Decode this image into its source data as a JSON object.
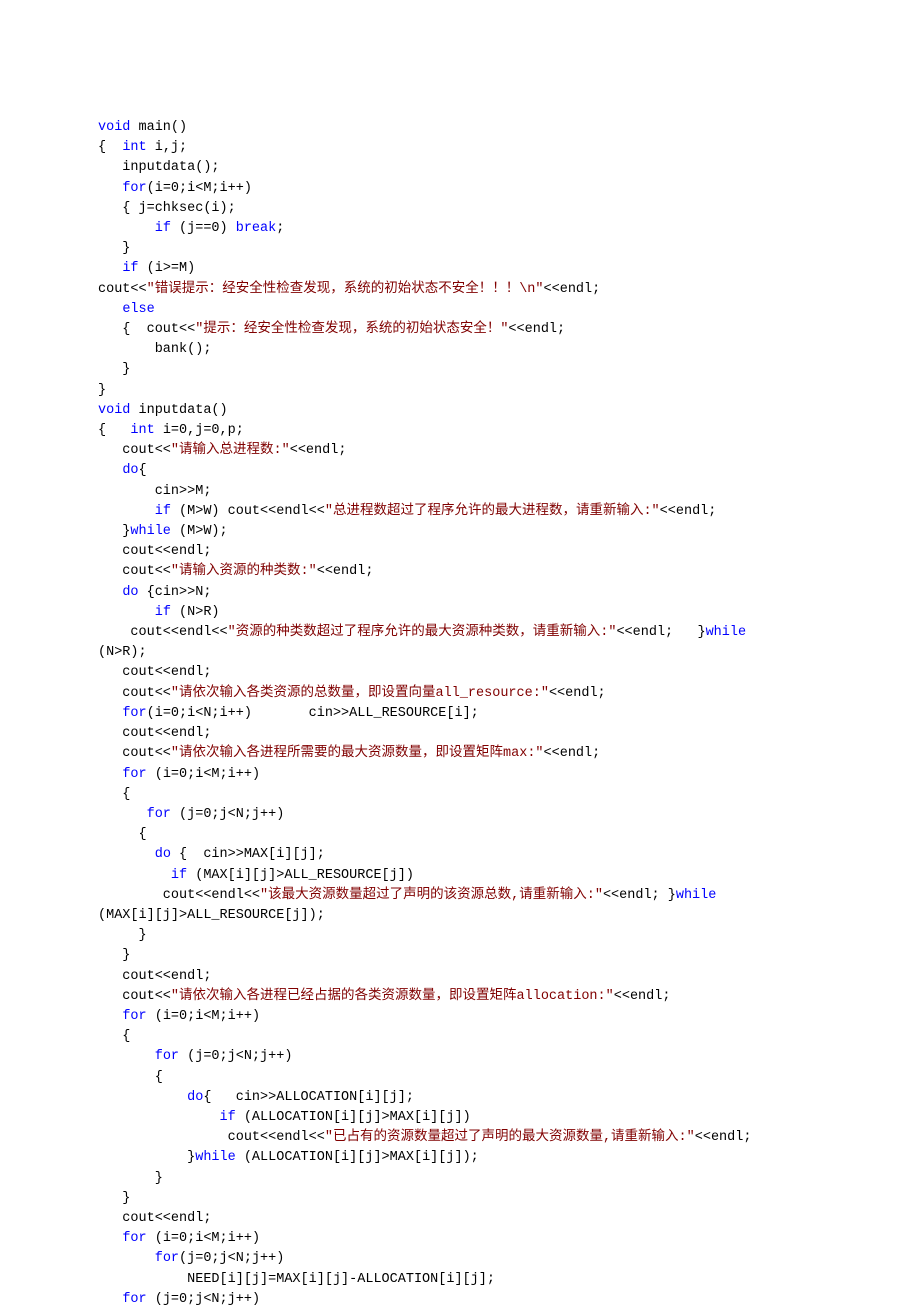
{
  "code": {
    "lines": [
      [
        {
          "c": "tp",
          "t": "void"
        },
        {
          "c": "",
          "t": " main()"
        }
      ],
      [
        {
          "c": "",
          "t": "{  "
        },
        {
          "c": "tp",
          "t": "int"
        },
        {
          "c": "",
          "t": " i,j;"
        }
      ],
      [
        {
          "c": "",
          "t": "   inputdata();"
        }
      ],
      [
        {
          "c": "",
          "t": "   "
        },
        {
          "c": "kw",
          "t": "for"
        },
        {
          "c": "",
          "t": "(i=0;i<M;i++)"
        }
      ],
      [
        {
          "c": "",
          "t": "   { j=chksec(i);"
        }
      ],
      [
        {
          "c": "",
          "t": "       "
        },
        {
          "c": "kw",
          "t": "if"
        },
        {
          "c": "",
          "t": " (j==0) "
        },
        {
          "c": "kw",
          "t": "break"
        },
        {
          "c": "",
          "t": ";"
        }
      ],
      [
        {
          "c": "",
          "t": "   }"
        }
      ],
      [
        {
          "c": "",
          "t": "   "
        },
        {
          "c": "kw",
          "t": "if"
        },
        {
          "c": "",
          "t": " (i>=M)"
        }
      ],
      [
        {
          "c": "",
          "t": "cout<<"
        },
        {
          "c": "str",
          "t": "\"错误提示：经安全性检查发现，系统的初始状态不安全！！！\\n\""
        },
        {
          "c": "",
          "t": "<<endl;"
        }
      ],
      [
        {
          "c": "",
          "t": "   "
        },
        {
          "c": "kw",
          "t": "else"
        }
      ],
      [
        {
          "c": "",
          "t": "   {  cout<<"
        },
        {
          "c": "str",
          "t": "\"提示：经安全性检查发现，系统的初始状态安全！\""
        },
        {
          "c": "",
          "t": "<<endl;"
        }
      ],
      [
        {
          "c": "",
          "t": "       bank();"
        }
      ],
      [
        {
          "c": "",
          "t": "   }"
        }
      ],
      [
        {
          "c": "",
          "t": "}"
        }
      ],
      [
        {
          "c": "tp",
          "t": "void"
        },
        {
          "c": "",
          "t": " inputdata()"
        }
      ],
      [
        {
          "c": "",
          "t": "{   "
        },
        {
          "c": "tp",
          "t": "int"
        },
        {
          "c": "",
          "t": " i=0,j=0,p;"
        }
      ],
      [
        {
          "c": "",
          "t": "   cout<<"
        },
        {
          "c": "str",
          "t": "\"请输入总进程数:\""
        },
        {
          "c": "",
          "t": "<<endl;"
        }
      ],
      [
        {
          "c": "",
          "t": "   "
        },
        {
          "c": "kw",
          "t": "do"
        },
        {
          "c": "",
          "t": "{"
        }
      ],
      [
        {
          "c": "",
          "t": "       cin>>M;"
        }
      ],
      [
        {
          "c": "",
          "t": "       "
        },
        {
          "c": "kw",
          "t": "if"
        },
        {
          "c": "",
          "t": " (M>W) cout<<endl<<"
        },
        {
          "c": "str",
          "t": "\"总进程数超过了程序允许的最大进程数，请重新输入:\""
        },
        {
          "c": "",
          "t": "<<endl;"
        }
      ],
      [
        {
          "c": "",
          "t": "   }"
        },
        {
          "c": "kw",
          "t": "while"
        },
        {
          "c": "",
          "t": " (M>W);"
        }
      ],
      [
        {
          "c": "",
          "t": "   cout<<endl;"
        }
      ],
      [
        {
          "c": "",
          "t": "   cout<<"
        },
        {
          "c": "str",
          "t": "\"请输入资源的种类数:\""
        },
        {
          "c": "",
          "t": "<<endl;"
        }
      ],
      [
        {
          "c": "",
          "t": "   "
        },
        {
          "c": "kw",
          "t": "do"
        },
        {
          "c": "",
          "t": " {cin>>N;"
        }
      ],
      [
        {
          "c": "",
          "t": "       "
        },
        {
          "c": "kw",
          "t": "if"
        },
        {
          "c": "",
          "t": " (N>R)"
        }
      ],
      [
        {
          "c": "",
          "t": "    cout<<endl<<"
        },
        {
          "c": "str",
          "t": "\"资源的种类数超过了程序允许的最大资源种类数，请重新输入:\""
        },
        {
          "c": "",
          "t": "<<endl;   }"
        },
        {
          "c": "kw",
          "t": "while"
        }
      ],
      [
        {
          "c": "",
          "t": "(N>R);"
        }
      ],
      [
        {
          "c": "",
          "t": "   cout<<endl;"
        }
      ],
      [
        {
          "c": "",
          "t": "   cout<<"
        },
        {
          "c": "str",
          "t": "\"请依次输入各类资源的总数量，即设置向量all_resource:\""
        },
        {
          "c": "",
          "t": "<<endl;"
        }
      ],
      [
        {
          "c": "",
          "t": "   "
        },
        {
          "c": "kw",
          "t": "for"
        },
        {
          "c": "",
          "t": "(i=0;i<N;i++)       cin>>ALL_RESOURCE[i];"
        }
      ],
      [
        {
          "c": "",
          "t": "   cout<<endl;"
        }
      ],
      [
        {
          "c": "",
          "t": "   cout<<"
        },
        {
          "c": "str",
          "t": "\"请依次输入各进程所需要的最大资源数量，即设置矩阵max:\""
        },
        {
          "c": "",
          "t": "<<endl;"
        }
      ],
      [
        {
          "c": "",
          "t": "   "
        },
        {
          "c": "kw",
          "t": "for"
        },
        {
          "c": "",
          "t": " (i=0;i<M;i++)"
        }
      ],
      [
        {
          "c": "",
          "t": "   {"
        }
      ],
      [
        {
          "c": "",
          "t": "      "
        },
        {
          "c": "kw",
          "t": "for"
        },
        {
          "c": "",
          "t": " (j=0;j<N;j++)"
        }
      ],
      [
        {
          "c": "",
          "t": "     {"
        }
      ],
      [
        {
          "c": "",
          "t": "       "
        },
        {
          "c": "kw",
          "t": "do"
        },
        {
          "c": "",
          "t": " {  cin>>MAX[i][j];"
        }
      ],
      [
        {
          "c": "",
          "t": "         "
        },
        {
          "c": "kw",
          "t": "if"
        },
        {
          "c": "",
          "t": " (MAX[i][j]>ALL_RESOURCE[j])"
        }
      ],
      [
        {
          "c": "",
          "t": "        cout<<endl<<"
        },
        {
          "c": "str",
          "t": "\"该最大资源数量超过了声明的该资源总数,请重新输入:\""
        },
        {
          "c": "",
          "t": "<<endl; }"
        },
        {
          "c": "kw",
          "t": "while"
        }
      ],
      [
        {
          "c": "",
          "t": "(MAX[i][j]>ALL_RESOURCE[j]);"
        }
      ],
      [
        {
          "c": "",
          "t": "     }"
        }
      ],
      [
        {
          "c": "",
          "t": "   }"
        }
      ],
      [
        {
          "c": "",
          "t": "   cout<<endl;"
        }
      ],
      [
        {
          "c": "",
          "t": "   cout<<"
        },
        {
          "c": "str",
          "t": "\"请依次输入各进程已经占据的各类资源数量，即设置矩阵allocation:\""
        },
        {
          "c": "",
          "t": "<<endl;"
        }
      ],
      [
        {
          "c": "",
          "t": "   "
        },
        {
          "c": "kw",
          "t": "for"
        },
        {
          "c": "",
          "t": " (i=0;i<M;i++)"
        }
      ],
      [
        {
          "c": "",
          "t": "   {"
        }
      ],
      [
        {
          "c": "",
          "t": "       "
        },
        {
          "c": "kw",
          "t": "for"
        },
        {
          "c": "",
          "t": " (j=0;j<N;j++)"
        }
      ],
      [
        {
          "c": "",
          "t": "       {"
        }
      ],
      [
        {
          "c": "",
          "t": "           "
        },
        {
          "c": "kw",
          "t": "do"
        },
        {
          "c": "",
          "t": "{   cin>>ALLOCATION[i][j];"
        }
      ],
      [
        {
          "c": "",
          "t": "               "
        },
        {
          "c": "kw",
          "t": "if"
        },
        {
          "c": "",
          "t": " (ALLOCATION[i][j]>MAX[i][j])"
        }
      ],
      [
        {
          "c": "",
          "t": "                cout<<endl<<"
        },
        {
          "c": "str",
          "t": "\"已占有的资源数量超过了声明的最大资源数量,请重新输入:\""
        },
        {
          "c": "",
          "t": "<<endl;"
        }
      ],
      [
        {
          "c": "",
          "t": "           }"
        },
        {
          "c": "kw",
          "t": "while"
        },
        {
          "c": "",
          "t": " (ALLOCATION[i][j]>MAX[i][j]);"
        }
      ],
      [
        {
          "c": "",
          "t": "       }"
        }
      ],
      [
        {
          "c": "",
          "t": "   }"
        }
      ],
      [
        {
          "c": "",
          "t": "   cout<<endl;"
        }
      ],
      [
        {
          "c": "",
          "t": "   "
        },
        {
          "c": "kw",
          "t": "for"
        },
        {
          "c": "",
          "t": " (i=0;i<M;i++)"
        }
      ],
      [
        {
          "c": "",
          "t": "       "
        },
        {
          "c": "kw",
          "t": "for"
        },
        {
          "c": "",
          "t": "(j=0;j<N;j++)"
        }
      ],
      [
        {
          "c": "",
          "t": "           NEED[i][j]=MAX[i][j]-ALLOCATION[i][j];"
        }
      ],
      [
        {
          "c": "",
          "t": "   "
        },
        {
          "c": "kw",
          "t": "for"
        },
        {
          "c": "",
          "t": " (j=0;j<N;j++)"
        }
      ]
    ]
  }
}
